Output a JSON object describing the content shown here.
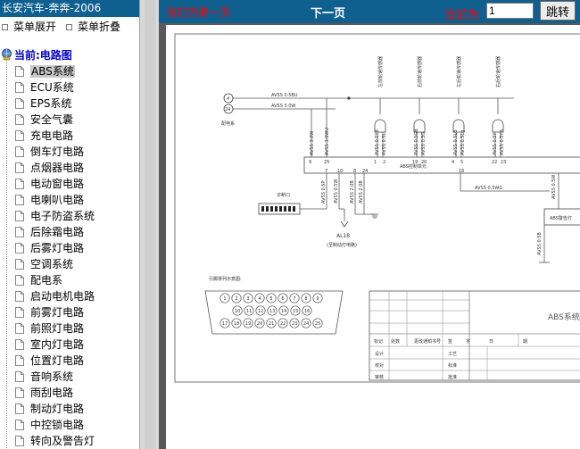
{
  "app_title": "长安汽车-奔奔-2006",
  "menu_toolbar": {
    "expand_label": "菜单展开",
    "collapse_label": "菜单折叠"
  },
  "tree": {
    "root_label": "当前:电路图",
    "items": [
      "ABS系统",
      "ECU系统",
      "EPS系统",
      "安全气囊",
      "充电电路",
      "倒车灯电路",
      "点烟器电路",
      "电动窗电路",
      "电喇叭电路",
      "电子防盗系统",
      "后除霜电路",
      "后雾灯电路",
      "空调系统",
      "配电系",
      "启动电机电路",
      "前雾灯电路",
      "前照灯电路",
      "室内灯电路",
      "位置灯电路",
      "音响系统",
      "雨刮电路",
      "制动灯电路",
      "中控锁电路",
      "转向及警告灯"
    ],
    "selected_index": 0
  },
  "toolbar": {
    "status_text": "当前为第一页",
    "next_page_label": "下一页",
    "current_label": "当前为",
    "page_value": "1",
    "jump_label": "跳转"
  },
  "diagram": {
    "sensor_labels": [
      "左前轮速传感器",
      "右前轮速传感器",
      "左后轮速传感器",
      "右后轮速传感器"
    ],
    "wire_bu": "AVSS 0.5BU",
    "wire_w": "AVSS 3.0W",
    "relay_label": "配电系",
    "relay_pins": [
      "4",
      "24"
    ],
    "wires_top": [
      "AVSS 3.0W",
      "AVSS 3.0WU",
      "AVSS 0.5YB",
      "AVSS 0.5L",
      "AVSS 0.5GB",
      "AVSS 0.5G",
      "AVSS 0.5LB",
      "AVSS 0.5Lg",
      "AVSS 0.5Y",
      "AVSS 0.5YB"
    ],
    "unit_label": "ABS控制单元",
    "unit_pins_top": [
      "9",
      "25",
      "1",
      "2",
      "19",
      "20",
      "4",
      "5",
      "22",
      "23"
    ],
    "unit_pins_bottom": [
      "7",
      "10",
      "8",
      "24",
      "16"
    ],
    "wire_wg": "AVSS 0.5WG",
    "wire_w_right": "AVSS 0.5W",
    "wires_bottom": [
      "AVSS 0.5P",
      "AVSS 0.5W",
      "AVSS 2.0B",
      "AVSS 2.0B"
    ],
    "diag_label": "诊断口",
    "al_label": "AL18",
    "al_sub": "(至制动灯电路)",
    "warn_label": "ABS警告灯",
    "wire_right_b": "AVSS 0.5B",
    "pinout_title": "引脚排列示意图:",
    "pins_row1": [
      "1",
      "2",
      "3",
      "4",
      "5",
      "6",
      "7",
      "8",
      "9"
    ],
    "pins_row2": [
      "10",
      "11",
      "12",
      "13",
      "14",
      "15",
      "16"
    ],
    "pins_row3": [
      "17",
      "18",
      "19",
      "20",
      "21",
      "22",
      "23",
      "24",
      "25"
    ],
    "block_title": "ABS系统",
    "tb_headers": [
      "标记",
      "处数",
      "更改通知书号",
      "签",
      "字",
      "日",
      "期"
    ],
    "tb_rows": [
      [
        "设计",
        "工艺"
      ],
      [
        "校对",
        "标准"
      ],
      [
        "审核",
        "批准"
      ]
    ]
  }
}
